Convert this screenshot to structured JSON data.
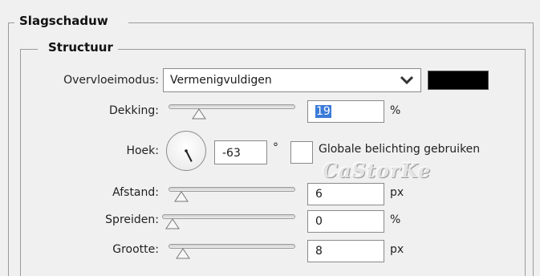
{
  "outer_group": {
    "title": "Slagschaduw"
  },
  "inner_group": {
    "title": "Structuur"
  },
  "blend": {
    "label": "Overvloeimodus:",
    "value": "Vermenigvuldigen",
    "color": "#000000"
  },
  "opacity": {
    "label": "Dekking:",
    "value": "19",
    "unit": "%",
    "slider_level": 0.19
  },
  "angle": {
    "label": "Hoek:",
    "value": "-63",
    "unit": "°",
    "degrees": -63
  },
  "global_light": {
    "label": "Globale belichting gebruiken",
    "checked": false
  },
  "watermark": "CaStorKe",
  "distance": {
    "label": "Afstand:",
    "value": "6",
    "unit": "px",
    "slider_level": 0.02
  },
  "spread": {
    "label": "Spreiden:",
    "value": "0",
    "unit": "%",
    "slider_level": 0.0
  },
  "size": {
    "label": "Grootte:",
    "value": "8",
    "unit": "px",
    "slider_level": 0.04
  },
  "icons": {
    "dropdown": "chevron-down-icon",
    "slider": "slider-thumb-icon"
  }
}
